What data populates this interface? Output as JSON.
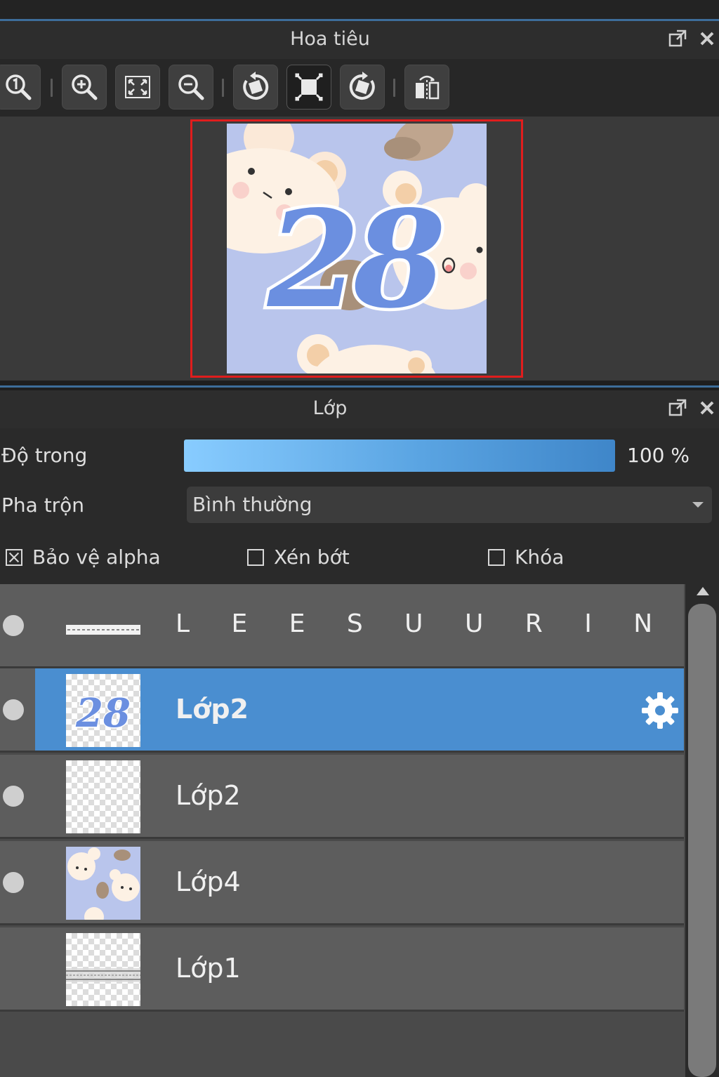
{
  "navigator": {
    "title": "Hoa tiêu",
    "header_icons": [
      "popout-icon",
      "close-icon"
    ],
    "toolbar_icons": [
      "zoom-actual-icon",
      "zoom-in-icon",
      "fit-screen-icon",
      "zoom-out-icon",
      "rotate-left-icon",
      "reset-view-icon",
      "rotate-right-icon",
      "flip-horizontal-icon"
    ],
    "preview_text": "28"
  },
  "layers_panel": {
    "title": "Lớp",
    "opacity_label": "Độ trong",
    "opacity_value": "100 %",
    "opacity_fraction": 1.0,
    "blend_label": "Pha trộn",
    "blend_value": "Bình thường",
    "protect_alpha_label": "Bảo vệ alpha",
    "protect_alpha_checked": true,
    "clipping_label": "Xén bớt",
    "clipping_checked": false,
    "lock_label": "Khóa",
    "lock_checked": false
  },
  "layers": [
    {
      "name": "L E E S U U R I N",
      "visible": true,
      "selected": false,
      "thumb": "text-strip"
    },
    {
      "name": "Lớp2",
      "visible": true,
      "selected": true,
      "thumb": "number-28",
      "thumb_text": "28"
    },
    {
      "name": "Lớp2",
      "visible": true,
      "selected": false,
      "thumb": "transparent"
    },
    {
      "name": "Lớp4",
      "visible": true,
      "selected": false,
      "thumb": "bears"
    },
    {
      "name": "Lớp1",
      "visible": false,
      "selected": false,
      "thumb": "lace"
    }
  ],
  "colors": {
    "accent": "#4a8ed0",
    "frame_red": "#e01d1d",
    "art_background": "#b9c5ec",
    "number_blue": "#5a7fd6"
  }
}
